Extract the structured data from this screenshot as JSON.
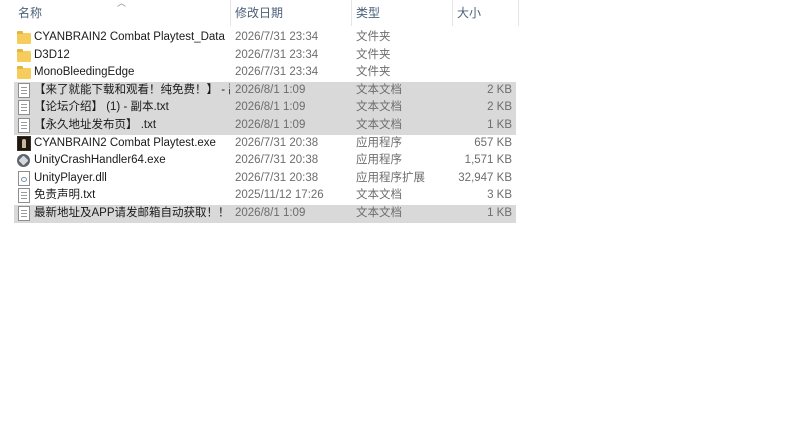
{
  "columns": {
    "name": "名称",
    "date": "修改日期",
    "type": "类型",
    "size": "大小"
  },
  "files": [
    {
      "name": "CYANBRAIN2 Combat Playtest_Data",
      "date": "2026/7/31 23:34",
      "type": "文件夹",
      "size": "",
      "icon": "folder-icon",
      "selected": false
    },
    {
      "name": "D3D12",
      "date": "2026/7/31 23:34",
      "type": "文件夹",
      "size": "",
      "icon": "folder-icon",
      "selected": false
    },
    {
      "name": "MonoBleedingEdge",
      "date": "2026/7/31 23:34",
      "type": "文件夹",
      "size": "",
      "icon": "folder-icon",
      "selected": false
    },
    {
      "name": "【来了就能下载和观看！纯免费！】 - 副...",
      "date": "2026/8/1 1:09",
      "type": "文本文档",
      "size": "2 KB",
      "icon": "text-file-icon",
      "selected": true
    },
    {
      "name": "【论坛介绍】 (1) - 副本.txt",
      "date": "2026/8/1 1:09",
      "type": "文本文档",
      "size": "2 KB",
      "icon": "text-file-icon",
      "selected": true
    },
    {
      "name": "【永久地址发布页】 .txt",
      "date": "2026/8/1 1:09",
      "type": "文本文档",
      "size": "1 KB",
      "icon": "text-file-icon",
      "selected": true
    },
    {
      "name": "CYANBRAIN2 Combat Playtest.exe",
      "date": "2026/7/31 20:38",
      "type": "应用程序",
      "size": "657 KB",
      "icon": "game-exe-icon",
      "selected": false
    },
    {
      "name": "UnityCrashHandler64.exe",
      "date": "2026/7/31 20:38",
      "type": "应用程序",
      "size": "1,571 KB",
      "icon": "unity-exe-icon",
      "selected": false
    },
    {
      "name": "UnityPlayer.dll",
      "date": "2026/7/31 20:38",
      "type": "应用程序扩展",
      "size": "32,947 KB",
      "icon": "dll-file-icon",
      "selected": false
    },
    {
      "name": "免责声明.txt",
      "date": "2025/11/12 17:26",
      "type": "文本文档",
      "size": "3 KB",
      "icon": "text-file-icon",
      "selected": false
    },
    {
      "name": "最新地址及APP请发邮箱自动获取！！！ ...",
      "date": "2026/8/1 1:09",
      "type": "文本文档",
      "size": "1 KB",
      "icon": "text-file-icon",
      "selected": true
    }
  ]
}
